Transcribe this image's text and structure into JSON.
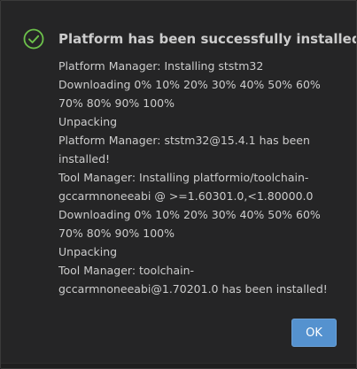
{
  "dialog": {
    "title": "Platform has been successfully installed",
    "icon": "check-circle-icon",
    "accent_color": "#6dc24b",
    "lines": [
      "Platform Manager: Installing ststm32",
      "Downloading 0% 10% 20% 30% 40% 50% 60%",
      "70% 80% 90% 100%",
      "Unpacking",
      "Platform Manager: ststm32@15.4.1 has been",
      "installed!",
      "Tool Manager: Installing platformio/toolchain-",
      "gccarmnoneeabi @ >=1.60301.0,<1.80000.0",
      "Downloading 0% 10% 20% 30% 40% 50% 60%",
      "70% 80% 90% 100%",
      "Unpacking",
      "Tool Manager: toolchain-",
      "gccarmnoneeabi@1.70201.0 has been installed!"
    ],
    "ok_label": "OK",
    "button_color": "#5592cf"
  }
}
